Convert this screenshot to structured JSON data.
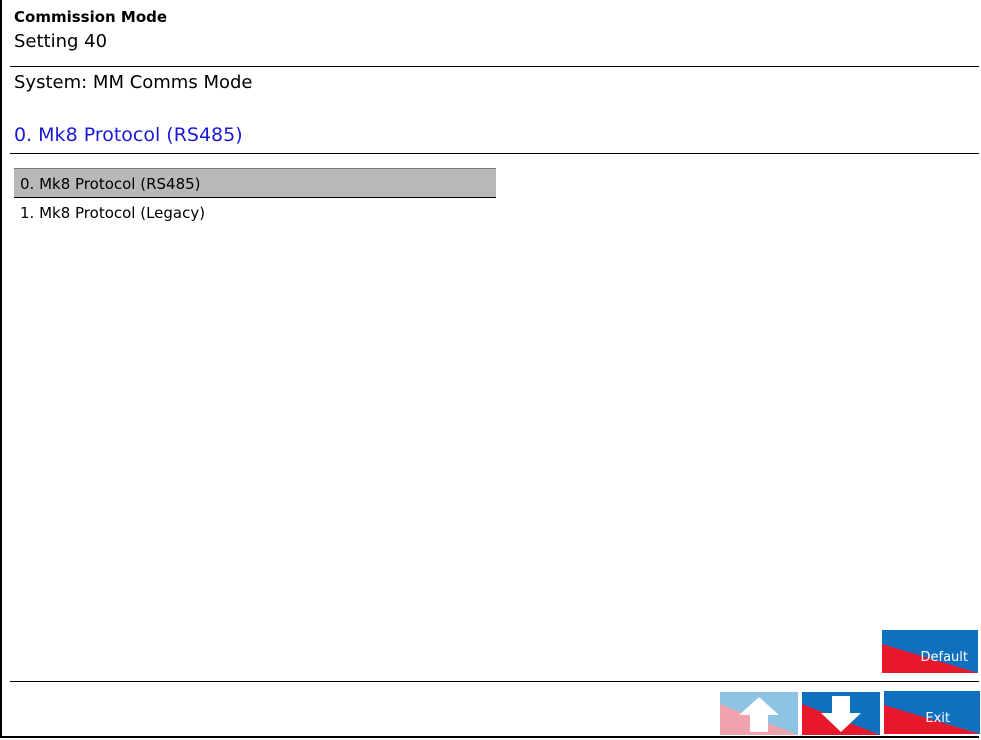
{
  "header": {
    "mode_title": "Commission Mode",
    "setting_number": "Setting 40",
    "system_name": "System: MM Comms Mode",
    "current_value": "0. Mk8 Protocol (RS485)"
  },
  "options": [
    {
      "label": "0. Mk8 Protocol (RS485)",
      "selected": true
    },
    {
      "label": "1. Mk8 Protocol (Legacy)",
      "selected": false
    }
  ],
  "buttons": {
    "default_label": "Default",
    "exit_label": "Exit",
    "up_enabled": false,
    "down_enabled": true
  },
  "colors": {
    "accent_blue": "#1070c0",
    "accent_red": "#e8182c",
    "disabled_blue": "#8ec3e3",
    "disabled_red": "#f1a3ad",
    "value_text": "#1a1ad6",
    "selected_row": "#b8b8b8"
  }
}
